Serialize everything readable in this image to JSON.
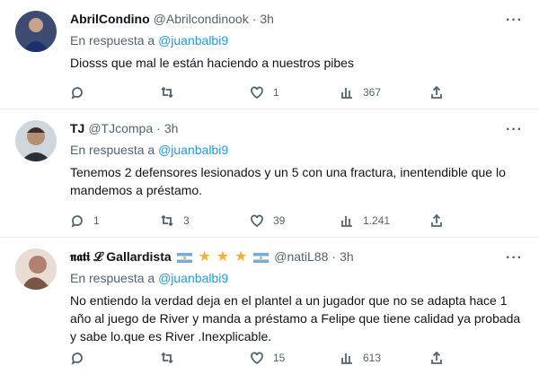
{
  "tweets": [
    {
      "name": "AbrilCondino",
      "handle": "@Abrilcondinook",
      "time": "3h",
      "reply_prefix": "En respuesta a",
      "reply_to": "@juanbalbi9",
      "text": "Diosss que mal le están haciendo a nuestros pibes",
      "stats": {
        "replies": "",
        "retweets": "",
        "likes": "1",
        "views": "367"
      }
    },
    {
      "name": "TJ",
      "handle": "@TJcompa",
      "time": "3h",
      "reply_prefix": "En respuesta a",
      "reply_to": "@juanbalbi9",
      "text": "Tenemos 2 defensores lesionados y un 5 con  una fractura, inentendible que lo mandemos a préstamo.",
      "stats": {
        "replies": "1",
        "retweets": "3",
        "likes": "39",
        "views": "1.241"
      }
    },
    {
      "name": "𝖓𝖆𝖙𝖎 ℒ Gallardista",
      "handle": "@natiL88",
      "time": "3h",
      "reply_prefix": "En respuesta a",
      "reply_to": "@juanbalbi9",
      "text": "No entiendo la verdad deja en el plantel a un jugador que no se adapta hace 1 año al juego de River y manda a préstamo a Felipe que tiene calidad ya probada y sabe lo.que es River .Inexplicable.",
      "stats": {
        "replies": "",
        "retweets": "",
        "likes": "15",
        "views": "613"
      }
    }
  ],
  "more_glyph": "···",
  "star_glyph": "★",
  "colors": {
    "link": "#1d9bf0",
    "muted": "#536471",
    "star": "#ffac33"
  }
}
